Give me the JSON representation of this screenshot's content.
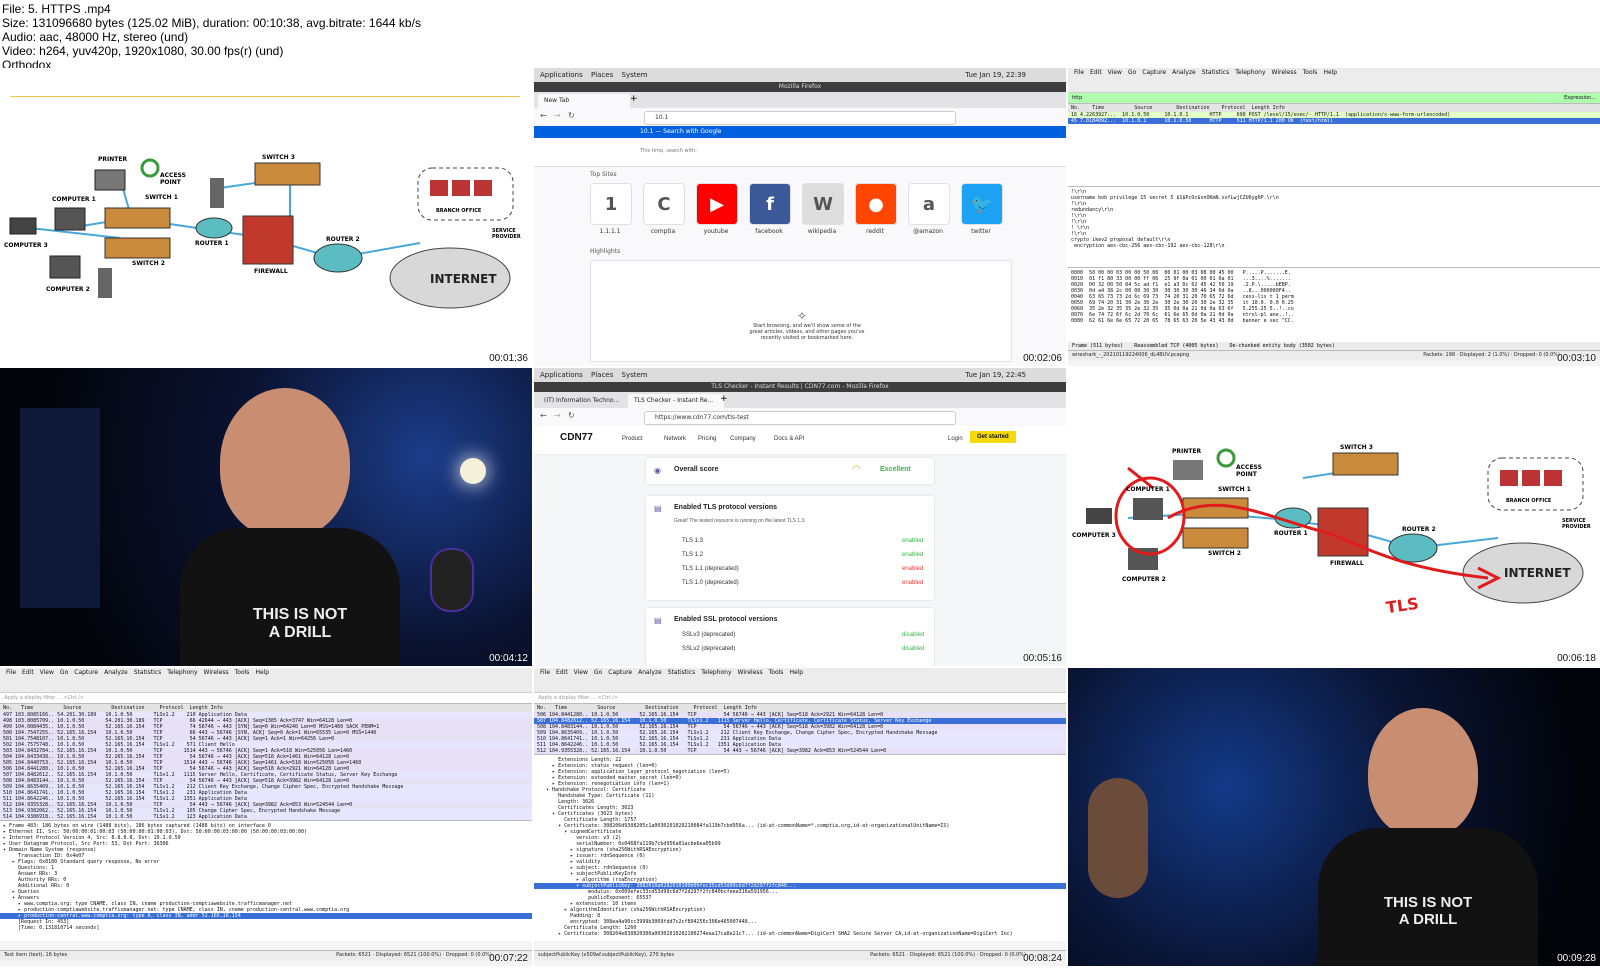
{
  "header": {
    "line1": "File: 5. HTTPS .mp4",
    "line2": "Size: 131096680 bytes (125.02 MiB), duration: 00:10:38, avg.bitrate: 1644 kb/s",
    "line3": "Audio: aac, 48000 Hz, stereo (und)",
    "line4": "Video: h264, yuv420p, 1920x1080, 30.00 fps(r) (und)",
    "line5": "Orthodox"
  },
  "timestamps": [
    "00:01:36",
    "00:02:06",
    "00:03:10",
    "00:04:12",
    "00:05:16",
    "00:06:18",
    "00:07:22",
    "00:08:24",
    "00:09:28"
  ],
  "diagram": {
    "labels": {
      "printer": "PRINTER",
      "access_point": "ACCESS POINT",
      "switch3": "SWITCH 3",
      "computer1": "COMPUTER 1",
      "switch1": "SWITCH 1",
      "computer3": "COMPUTER 3",
      "router1": "ROUTER 1",
      "router2": "ROUTER 2",
      "switch2": "SWITCH 2",
      "firewall": "FIREWALL",
      "computer2": "COMPUTER 2",
      "internet": "INTERNET",
      "service_provider": "SERVICE PROVIDER",
      "branch_office": "BRANCH OFFICE"
    },
    "annotation": "TLS"
  },
  "firefox_newtab": {
    "gnome": {
      "apps": "Applications",
      "places": "Places",
      "system": "System",
      "clock": "Tue Jan 19, 22:39"
    },
    "window_title": "Mozilla Firefox",
    "tab": "New Tab",
    "url_value": "10.1",
    "suggestion": "10.1 — Search with Google",
    "search_hint": "This time, search with:",
    "top_sites_label": "Top Sites",
    "highlights_label": "Highlights",
    "top_sites": [
      {
        "label": "1.1.1.1",
        "glyph": "1",
        "color": "#ffffff"
      },
      {
        "label": "comptia",
        "glyph": "C",
        "color": "#ffffff"
      },
      {
        "label": "youtube",
        "glyph": "▶",
        "color": "#ff0000"
      },
      {
        "label": "facebook",
        "glyph": "f",
        "color": "#3b5998"
      },
      {
        "label": "wikipedia",
        "glyph": "W",
        "color": "#dddddd"
      },
      {
        "label": "reddit",
        "glyph": "●",
        "color": "#ff4500"
      },
      {
        "label": "@amazon",
        "glyph": "a",
        "color": "#ffffff"
      },
      {
        "label": "twitter",
        "glyph": "🐦",
        "color": "#1da1f2"
      }
    ],
    "empty_text": "Start browsing, and we'll show some of the great articles, videos, and other pages you've recently visited or bookmarked here."
  },
  "wireshark_http": {
    "menu": [
      "File",
      "Edit",
      "View",
      "Go",
      "Capture",
      "Analyze",
      "Statistics",
      "Telephony",
      "Wireless",
      "Tools",
      "Help"
    ],
    "filter": "http",
    "expression": "Expression...",
    "columns": "No.    Time          Source        Destination    Protocol  Length Info",
    "rows": [
      "16 4.2263927...  10.1.0.50     10.1.0.1       HTTP     690 POST /level/15/exec/- HTTP/1.1  (application/x-www-form-urlencoded)",
      "45 7.0184092...  10.1.0.1      10.1.0.50      HTTP     511 HTTP/1.1 200 OK  (text/html)"
    ],
    "detail": [
      "!\\r\\n",
      "username bob privilege 15 secret 5 $1$PcOc$onOKmN.xvfLwjCZU6yg0P.\\r\\n",
      "!\\r\\n",
      "redundancy\\r\\n",
      "!\\r\\n",
      "!\\r\\n",
      "! \\r\\n",
      "!\\r\\n",
      "crypto ikev2 proposal default\\r\\n",
      " encryption aes-cbc-256 aes-cbc-192 aes-cbc-128\\r\\n"
    ],
    "hex": [
      "0000  50 00 00 03 00 00 50 00  00 01 00 03 08 00 45 00   P.....P.......E.",
      "0010  01 f1 80 33 00 00 ff 06  25 9f 0a 01 00 01 0a 01   ...3....%.......",
      "0020  00 32 00 50 84 5c ad f1  e1 a3 0c 62 45 42 50 19   .2.P.\\.....bEBP.",
      "0030  0d a4 38 2c 00 00 30 30  30 30 30 30 46 34 0d 0a   ..8,..000000F4..",
      "0040  63 65 73 73 2d 6c 69 73  74 20 31 20 70 65 72 6d   cess-lis t 1 perm",
      "0050  69 74 20 31 30 2e 30 2e  30 2e 30 20 30 2e 32 35   it 10.0. 0.0 0.25",
      "0060  35 2e 32 35 35 2e 32 35  35 0d 0a 21 0d 0a 63 6f   5.255.25 5..!..co",
      "0070  6e 74 72 6f 6c 2d 70 6c  61 6e 65 0d 0a 21 0d 0a   ntrol-pl ane..!..",
      "0080  62 61 6e 6e 65 72 20 65  78 65 63 20 5e 43 43 0d   banner e xec ^CC."
    ],
    "hex_tabs": [
      "Frame (511 bytes)",
      "Reassembled TCP (4005 bytes)",
      "De-chunked entity body (3502 bytes)"
    ],
    "status_left": "wireshark_-_20210119224006_dL4BUV.pcapng",
    "status_right": "Packets: 198 · Displayed: 2 (1.0%) · Dropped: 0 (0.0%)",
    "profile": "Profile: Default"
  },
  "cdn77": {
    "gnome": {
      "apps": "Applications",
      "places": "Places",
      "system": "System",
      "clock": "Tue Jan 19, 22:45"
    },
    "window_title": "TLS Checker - Instant Results | CDN77.com - Mozilla Firefox",
    "tabs": [
      "(IT) Information Techno...",
      "TLS Checker - Instant Re..."
    ],
    "url": "https://www.cdn77.com/tls-test",
    "logo": "CDN77",
    "nav": [
      "Product",
      "Network",
      "Pricing",
      "Company",
      "Docs & API"
    ],
    "login": "Login",
    "cta": "Get started",
    "overall_label": "Overall score",
    "overall_value": "Excellent",
    "tls_title": "Enabled TLS protocol versions",
    "tls_desc": "Great! The tested resource is running on the latest TLS 1.3.",
    "tls_rows": [
      {
        "name": "TLS 1.3",
        "status": "enabled",
        "color": "#39b54a"
      },
      {
        "name": "TLS 1.2",
        "status": "enabled",
        "color": "#39b54a"
      },
      {
        "name": "TLS 1.1 (deprecated)",
        "status": "enabled",
        "color": "#e53935"
      },
      {
        "name": "TLS 1.0 (deprecated)",
        "status": "enabled",
        "color": "#e53935"
      }
    ],
    "ssl_title": "Enabled SSL protocol versions",
    "ssl_rows": [
      {
        "name": "SSLv3 (deprecated)",
        "status": "disabled",
        "color": "#39b54a"
      },
      {
        "name": "SSLv2 (deprecated)",
        "status": "disabled",
        "color": "#39b54a"
      }
    ]
  },
  "wireshark_dns": {
    "filter": "Apply a display filter ... <Ctrl-/>",
    "columns": "No.   Time          Source          Destination     Protocol  Length Info",
    "rows": [
      {
        "t": "497 103.8085166.. 54.201.30.189   10.1.0.50       TLSv1.2    210 Application Data",
        "c": "tls"
      },
      {
        "t": "498 103.8085709.. 10.1.0.50       54.201.30.189   TCP         66 42644 → 443 [ACK] Seq=1385 Ack=3747 Win=64128 Len=0",
        "c": "tcp"
      },
      {
        "t": "499 104.0084435.. 10.1.0.50       52.165.16.154   TCP         74 56746 → 443 [SYN] Seq=0 Win=64240 Len=0 MSS=1460 SACK_PERM=1",
        "c": "tcp"
      },
      {
        "t": "500 104.7547255.. 52.165.16.154   10.1.0.50       TCP         66 443 → 56746 [SYN, ACK] Seq=0 Ack=1 Win=65535 Len=0 MSS=1440",
        "c": "tcp"
      },
      {
        "t": "501 104.7548107.. 10.1.0.50       52.165.16.154   TCP         54 56746 → 443 [ACK] Seq=1 Ack=1 Win=64256 Len=0",
        "c": "tcp"
      },
      {
        "t": "502 104.7575748.. 10.1.0.50       52.165.16.154   TLSv1.2    571 Client Hello",
        "c": "tls"
      },
      {
        "t": "503 104.8432784.. 52.165.16.154   10.1.0.50       TCP       1514 443 → 56746 [ACK] Seq=1 Ack=518 Win=525056 Len=1460",
        "c": "tcp"
      },
      {
        "t": "504 104.8433438.. 10.1.0.50       52.165.16.154   TCP         54 56746 → 443 [ACK] Seq=518 Ack=1461 Win=64128 Len=0",
        "c": "tcp"
      },
      {
        "t": "505 104.8440753.. 52.165.16.154   10.1.0.50       TCP       1514 443 → 56746 [ACK] Seq=1461 Ack=518 Win=525056 Len=1460",
        "c": "tcp"
      },
      {
        "t": "506 104.8441280.. 10.1.0.50       52.165.16.154   TCP         54 56746 → 443 [ACK] Seq=518 Ack=2921 Win=64128 Len=0",
        "c": "tcp"
      },
      {
        "t": "507 104.8482612.. 52.165.16.154   10.1.0.50       TLSv1.2   1115 Server Hello, Certificate, Certificate Status, Server Key Exchange",
        "c": "tls"
      },
      {
        "t": "508 104.8483144.. 10.1.0.50       52.165.16.154   TCP         54 56746 → 443 [ACK] Seq=518 Ack=3982 Win=64128 Len=0",
        "c": "tcp"
      },
      {
        "t": "509 104.8635409.. 10.1.0.50       52.165.16.154   TLSv1.2    212 Client Key Exchange, Change Cipher Spec, Encrypted Handshake Message",
        "c": "tls"
      },
      {
        "t": "510 104.8641741.. 10.1.0.50       52.165.16.154   TLSv1.2    231 Application Data",
        "c": "tls"
      },
      {
        "t": "511 104.8642246.. 10.1.0.50       52.165.16.154   TLSv1.2   1351 Application Data",
        "c": "tls"
      },
      {
        "t": "512 104.9355328.. 52.165.16.154   10.1.0.50       TCP         54 443 → 56746 [ACK] Seq=3982 Ack=853 Win=524544 Len=0",
        "c": "tcp"
      },
      {
        "t": "513 104.9382062.. 52.165.16.154   10.1.0.50       TLSv1.2    105 Change Cipher Spec, Encrypted Handshake Message",
        "c": "tls"
      },
      {
        "t": "514 104.9386918.. 52.165.16.154   10.1.0.50       TLSv1.2    123 Application Data",
        "c": "tls"
      }
    ],
    "detail": [
      "▸ Frame 483: 186 bytes on wire (1488 bits), 186 bytes captured (1488 bits) on interface 0",
      "▸ Ethernet II, Src: 50:00:00:01:00:03 (50:00:00:01:00:03), Dst: 50:00:00:03:00:00 (50:00:00:03:00:00)",
      "▸ Internet Protocol Version 4, Src: 8.8.8.8, Dst: 10.1.0.50",
      "▸ User Datagram Protocol, Src Port: 53, Dst Port: 36306",
      "▾ Domain Name System (response)",
      "     Transaction ID: 0x4e07",
      "   ▸ Flags: 0x8180 Standard query response, No error",
      "     Questions: 1",
      "     Answer RRs: 3",
      "     Authority RRs: 0",
      "     Additional RRs: 0",
      "   ▸ Queries",
      "   ▾ Answers",
      "     ▸ www.comptia.org: type CNAME, class IN, cname production-comptiawebsite.trafficmanager.net",
      "     ▸ production-comptiawebsite.trafficmanager.net: type CNAME, class IN, cname production-central.www.comptia.org",
      "     ▸ production-central.www.comptia.org: type A, class IN, addr 52.165.16.154",
      "     [Request In: 453]",
      "     [Time: 0.131810714 seconds]"
    ],
    "status_left": "Text item (text), 16 bytes",
    "status_right": "Packets: 6521 · Displayed: 6521 (100.0%) · Dropped: 0 (0.0%)"
  },
  "wireshark_cert": {
    "rows": [
      {
        "t": "506 104.8441280.. 10.1.0.50       52.165.16.154   TCP         54 56746 → 443 [ACK] Seq=518 Ack=2921 Win=64128 Len=0",
        "c": "tcp"
      },
      {
        "t": "507 104.8482612.. 52.165.16.154   10.1.0.50       TLSv1.2   1115 Server Hello, Certificate, Certificate Status, Server Key Exchange",
        "c": "sel"
      },
      {
        "t": "508 104.8483144.. 10.1.0.50       52.165.16.154   TCP         54 56746 → 443 [ACK] Seq=518 Ack=3982 Win=64128 Len=0",
        "c": "tcp"
      },
      {
        "t": "509 104.8635409.. 10.1.0.50       52.165.16.154   TLSv1.2    212 Client Key Exchange, Change Cipher Spec, Encrypted Handshake Message",
        "c": "tls"
      },
      {
        "t": "510 104.8641741.. 10.1.0.50       52.165.16.154   TLSv1.2    231 Application Data",
        "c": "tls"
      },
      {
        "t": "511 104.8642246.. 10.1.0.50       52.165.16.154   TLSv1.2   1351 Application Data",
        "c": "tls"
      },
      {
        "t": "512 104.9355328.. 52.165.16.154   10.1.0.50       TCP         54 443 → 56746 [ACK] Seq=3982 Ack=853 Win=524544 Len=0",
        "c": "tcp"
      }
    ],
    "detail": [
      "       Extensions Length: 22",
      "     ▸ Extension: status_request (len=0)",
      "     ▸ Extension: application_layer_protocol_negotiation (len=5)",
      "     ▸ Extension: extended_master_secret (len=0)",
      "     ▸ Extension: renegotiation_info (len=1)",
      "   ▾ Handshake Protocol: Certificate",
      "       Handshake Type: Certificate (11)",
      "       Length: 3026",
      "       Certificates Length: 3023",
      "     ▾ Certificates (3023 bytes)",
      "         Certificate Length: 1757",
      "       ▾ Certificate: 308206d9308205c1a0030201020210084fa119b7cbd956a... (id-at-commonName=*.comptia.org,id-at-organizationalUnitName=IS)",
      "         ▾ signedCertificate",
      "             version: v3 (2)",
      "             serialNumber: 0x0468fa119b7cbd956a01acbe6ea05b99",
      "           ▸ signature (sha256WithRSAEncryption)",
      "           ▸ issuer: rdnSequence (0)",
      "           ▸ validity",
      "           ▸ subject: rdnSequence (0)",
      "           ▾ subjectPublicKeyInfo",
      "             ▸ algorithm (rsaEncryption)",
      "             ▾ subjectPublicKey: 3082010a0282010100b09fec35cd53d99c6d7f2d297f2fc840...",
      "                 modulus: 0x009efec33cd53d99c6d7f2d297f2fc840bcfeea316a591956...",
      "                 publicExponent: 65537",
      "           ▸ extensions: 10 items",
      "         ▸ algorithmIdentifier (sha256WithRSAEncryption)",
      "           Padding: 0",
      "           encrypted: 308ea4a90cc3999b3069fdd7c2cf804256c306e465007448...",
      "         Certificate Length: 1260",
      "       ▸ Certificate: 308204e830820300a00302010202100274eaa17ca8e21c7... (id-at-commonName=DigiCert SHA2 Secure Server CA,id-at-organizationName=DigiCert Inc)"
    ],
    "status_left": "subjectPublicKey (x509af.subjectPublicKey), 270 bytes",
    "status_right": "Packets: 6521 · Displayed: 6521 (100.0%) · Dropped: 0 (0.0%)",
    "profile": "Profile: Default"
  },
  "video_shirt": {
    "line1": "THIS IS NOT",
    "line2": "A DRILL"
  }
}
